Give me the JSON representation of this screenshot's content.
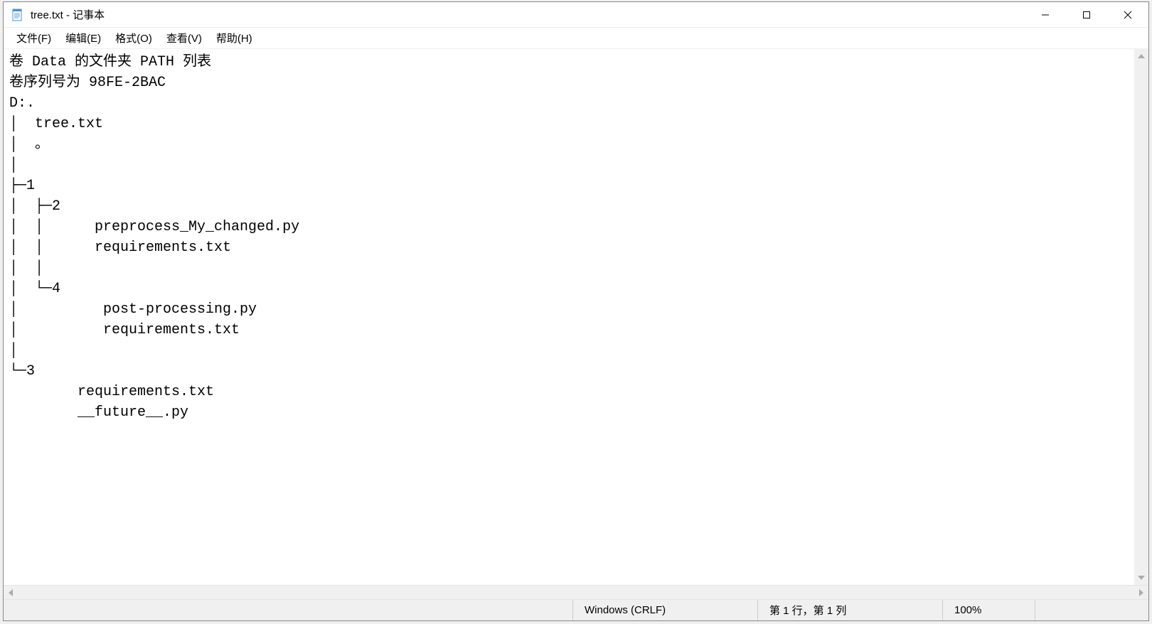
{
  "titlebar": {
    "title": "tree.txt - 记事本"
  },
  "menu": {
    "file": "文件(F)",
    "edit": "编辑(E)",
    "format": "格式(O)",
    "view": "查看(V)",
    "help": "帮助(H)"
  },
  "content": {
    "text": "卷 Data 的文件夹 PATH 列表\n卷序列号为 98FE-2BAC\nD:.\n│  tree.txt\n│  。\n│  \n├─1\n│  ├─2\n│  │      preprocess_My_changed.py\n│  │      requirements.txt\n│  │      \n│  └─4\n│          post-processing.py\n│          requirements.txt\n│          \n└─3\n        requirements.txt\n        __future__.py"
  },
  "statusbar": {
    "encoding": "Windows (CRLF)",
    "position": "第 1 行，第 1 列",
    "zoom": "100%"
  }
}
